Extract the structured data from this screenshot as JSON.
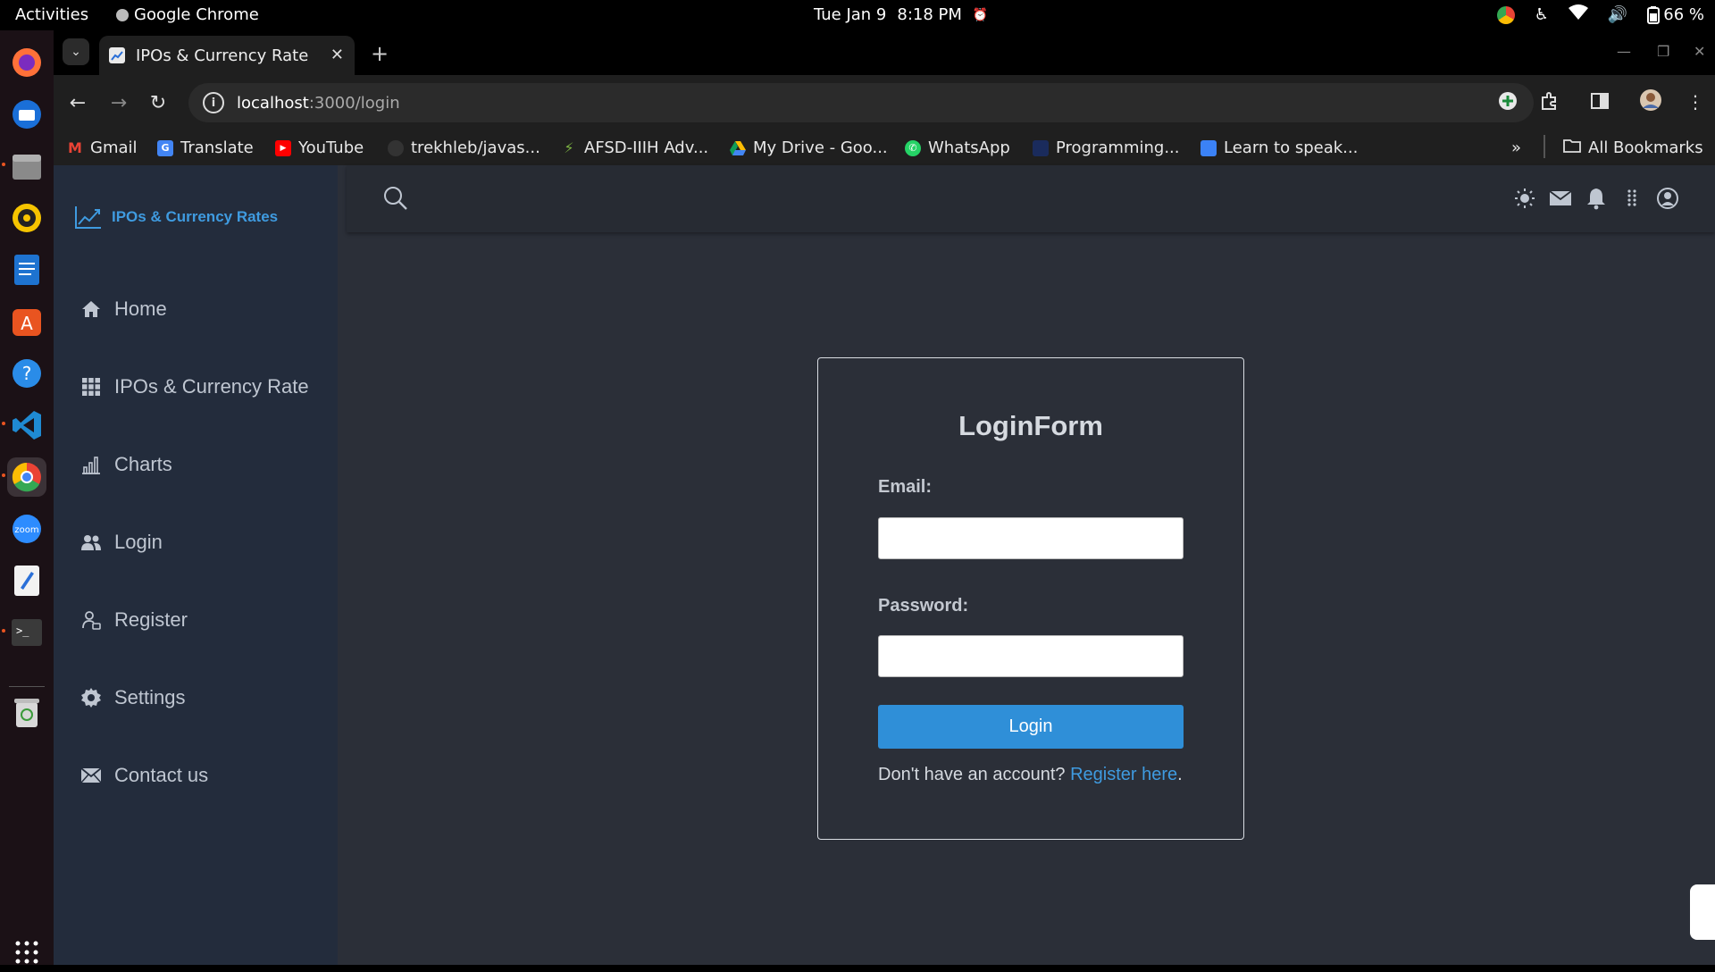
{
  "system_bar": {
    "activities": "Activities",
    "app_name": "Google Chrome",
    "date": "Tue Jan 9",
    "time": "8:18 PM",
    "battery": "66 %"
  },
  "browser": {
    "tab_title": "IPOs & Currency Rate",
    "url_host": "localhost",
    "url_path": ":3000/login",
    "bookmarks": [
      {
        "label": "Gmail",
        "icon": "gmail-icon",
        "color": "#ea4335"
      },
      {
        "label": "Translate",
        "icon": "translate-icon",
        "color": "#4285f4"
      },
      {
        "label": "YouTube",
        "icon": "youtube-icon",
        "color": "#ff0000"
      },
      {
        "label": "trekhleb/javas...",
        "icon": "github-icon",
        "color": "#333333"
      },
      {
        "label": "AFSD-IIIH Adv...",
        "icon": "run-icon",
        "color": "#7cb342"
      },
      {
        "label": "My Drive - Goo...",
        "icon": "drive-icon",
        "color": "#fbbc04"
      },
      {
        "label": "WhatsApp",
        "icon": "whatsapp-icon",
        "color": "#25d366"
      },
      {
        "label": "Programming...",
        "icon": "programming-icon",
        "color": "#1a2b5c"
      },
      {
        "label": "Learn to speak...",
        "icon": "learn-icon",
        "color": "#3b82f6"
      }
    ],
    "all_bookmarks": "All Bookmarks"
  },
  "sidebar": {
    "brand": "IPOs & Currency Rates",
    "items": [
      {
        "label": "Home",
        "icon": "home-icon"
      },
      {
        "label": "IPOs & Currency Rate",
        "icon": "grid-icon"
      },
      {
        "label": "Charts",
        "icon": "bar-chart-icon"
      },
      {
        "label": "Login",
        "icon": "users-icon"
      },
      {
        "label": "Register",
        "icon": "register-icon"
      },
      {
        "label": "Settings",
        "icon": "gear-icon"
      },
      {
        "label": "Contact us",
        "icon": "envelope-icon"
      }
    ]
  },
  "login_form": {
    "title": "LoginForm",
    "email_label": "Email:",
    "email_value": "",
    "password_label": "Password:",
    "password_value": "",
    "submit_label": "Login",
    "register_prompt": "Don't have an account?",
    "register_link": "Register here",
    "register_suffix": "."
  },
  "colors": {
    "accent": "#2f8fd8",
    "sidebar_bg": "#232c3c",
    "page_bg": "#2b2f38"
  }
}
